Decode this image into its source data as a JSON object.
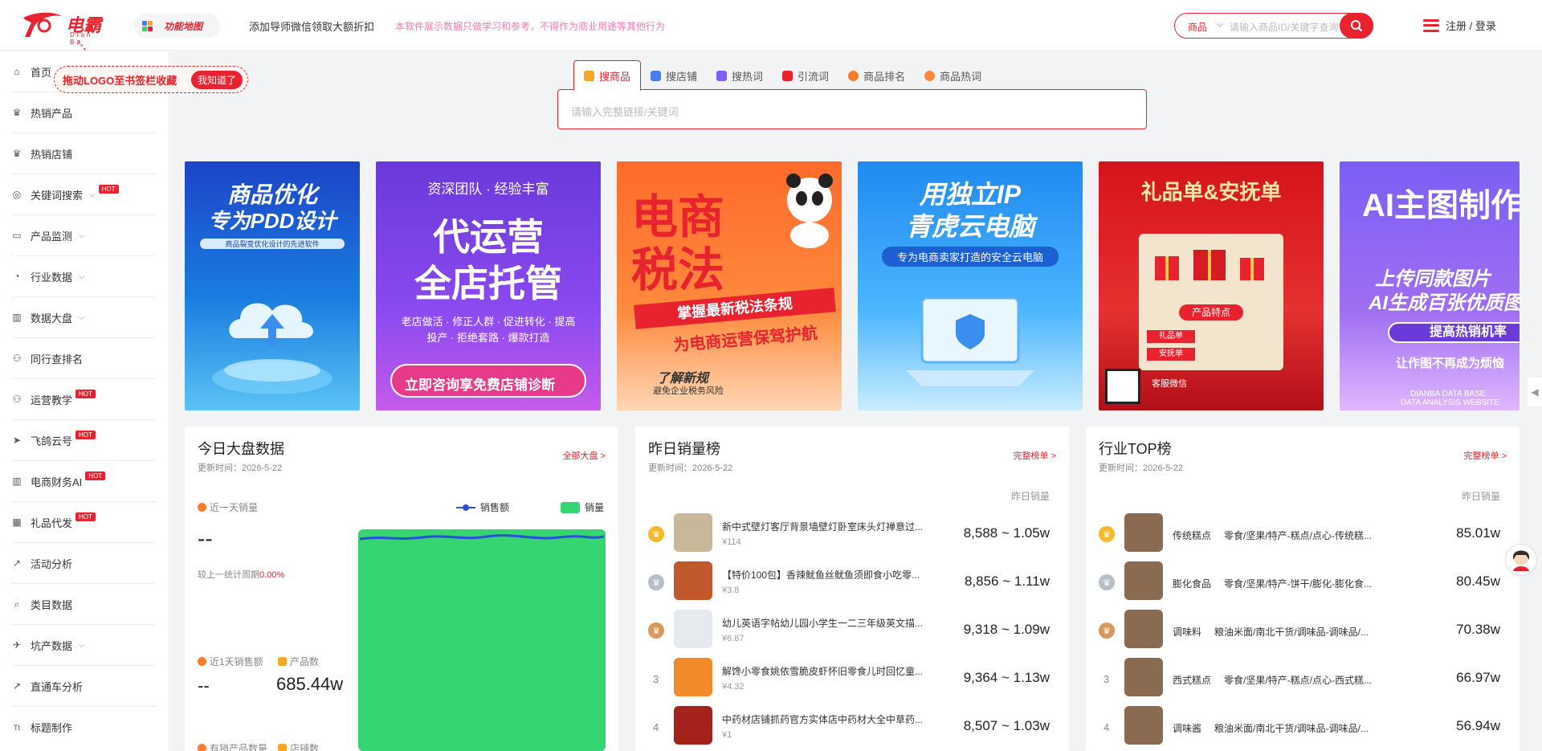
{
  "header": {
    "logo_text": "电霸",
    "logo_sub": "Dian Ba",
    "func_map": "功能地图",
    "notice": "添加导师微信领取大额折扣",
    "warning": "本软件展示数据只做学习和参考，不得作为商业用途等其他行为",
    "search_select": "商品",
    "search_placeholder": "请输入商品ID/关键字查询",
    "login": "注册 / 登录"
  },
  "tooltip": {
    "text": "拖动LOGO至书签栏收藏",
    "button": "我知道了"
  },
  "sidebar": {
    "items": [
      {
        "label": "首页",
        "icon": "home-icon"
      },
      {
        "label": "热销产品",
        "icon": "crown-icon"
      },
      {
        "label": "热销店铺",
        "icon": "crown-icon"
      },
      {
        "label": "关键词搜索",
        "icon": "search-icon",
        "chevron": true,
        "hot": "HOT"
      },
      {
        "label": "产品监测",
        "icon": "monitor-icon",
        "chevron": true
      },
      {
        "label": "行业数据",
        "icon": "pie-icon",
        "chevron": true
      },
      {
        "label": "数据大盘",
        "icon": "chart-icon",
        "chevron": true
      },
      {
        "label": "同行查排名",
        "icon": "users-icon"
      },
      {
        "label": "运营教学",
        "icon": "users-icon",
        "hot": "HOT"
      },
      {
        "label": "飞鸽云号",
        "icon": "send-icon",
        "hot": "HOT"
      },
      {
        "label": "电商财务AI",
        "icon": "chart-icon",
        "hot": "HOT"
      },
      {
        "label": "礼品代发",
        "icon": "gift-icon",
        "hot": "HOT"
      },
      {
        "label": "活动分析",
        "icon": "line-icon"
      },
      {
        "label": "类目数据",
        "icon": "search-icon"
      },
      {
        "label": "坑产数据",
        "icon": "rocket-icon",
        "chevron": true
      },
      {
        "label": "直通车分析",
        "icon": "line-icon"
      },
      {
        "label": "标题制作",
        "icon": "title-icon"
      }
    ]
  },
  "search_tabs": [
    {
      "label": "搜商品",
      "color": "#f5a623"
    },
    {
      "label": "搜店铺",
      "color": "#4a7cf5"
    },
    {
      "label": "搜热词",
      "color": "#7b5ef5"
    },
    {
      "label": "引流词",
      "color": "#e8232f"
    },
    {
      "label": "商品排名",
      "color": "#ff7a2a"
    },
    {
      "label": "商品热词",
      "color": "#ff8a3e"
    }
  ],
  "main_search_placeholder": "请输入完整链接/关键词",
  "banners": [
    {
      "t1": "商品优化",
      "t2": "专为PDD设计",
      "t3": "商品裂变优化设计的先进软件"
    },
    {
      "t1": "代运营",
      "t2": "全店托管",
      "t0": "资深团队 · 经验丰富",
      "t3": "老店做活 · 修正人群 · 促进转化 · 提高投产 · 拒绝套路 · 爆款打造",
      "t4": "立即咨询享免费店铺诊断"
    },
    {
      "t1": "电商",
      "t2": "税法",
      "t3": "掌握最新税法条规",
      "t4": "为电商运营保驾护航",
      "t5": "了解新规",
      "t6": "避免企业税务风险"
    },
    {
      "t1": "用独立IP",
      "t2": "青虎云电脑",
      "t3": "专为电商卖家打造的安全云电脑"
    },
    {
      "t1": "礼品单&安抚单",
      "t3": "产品特点",
      "t4": "礼品单",
      "t5": "安抚单",
      "t6": "客服微信"
    },
    {
      "t1": "AI主图制作",
      "t2": "上传同款图片",
      "t3": "AI生成百张优质图",
      "t4": "提高热销机率",
      "t5": "让作图不再成为烦恼",
      "t6": "DIANBA DATA BASE",
      "t7": "DATA ANALYSIS WEBSITE"
    }
  ],
  "panel_today": {
    "title": "今日大盘数据",
    "updated": "更新时间：2026-5-22",
    "link": "全部大盘 >",
    "kpi1_label": "近一天销量",
    "kpi1_value": "--",
    "compare_text": "较上一统计周期",
    "compare_value": "0.00%",
    "legend_sales_amount": "销售额",
    "legend_sales": "销量",
    "kpi2_label": "近1天销售额",
    "kpi2_value": "--",
    "kpi3_label": "产品数",
    "kpi3_value": "685.44w",
    "kpi4_label": "有销产品数量",
    "kpi5_label": "店铺数"
  },
  "panel_sales": {
    "title": "昨日销量榜",
    "updated": "更新时间：2026-5-22",
    "link": "完整榜单 >",
    "col": "昨日销量",
    "rows": [
      {
        "name": "新中式壁灯客厅背景墙壁灯卧室床头灯禅意过...",
        "price": "¥114",
        "value": "8,588 ~ 1.05w",
        "thumb": "#c9b79a"
      },
      {
        "name": "【特价100包】香辣鱿鱼丝鱿鱼须即食小吃零...",
        "price": "¥3.8",
        "value": "8,856 ~ 1.11w",
        "thumb": "#c0582b"
      },
      {
        "name": "幼儿英语字帖幼儿园小学生一二三年级英文描...",
        "price": "¥6.87",
        "value": "9,318 ~ 1.09w",
        "thumb": "#e6e9ee"
      },
      {
        "rank": "3",
        "name": "解馋小零食姚依雪脆皮虾怀旧零食儿时回忆童...",
        "price": "¥4.32",
        "value": "9,364 ~ 1.13w",
        "thumb": "#f08a2a"
      },
      {
        "rank": "4",
        "name": "中药材店铺抓药官方实体店中药材大全中草药...",
        "price": "¥1",
        "value": "8,507 ~ 1.03w",
        "thumb": "#a3221c"
      }
    ]
  },
  "panel_industry": {
    "title": "行业TOP榜",
    "updated": "更新时间：2026-5-22",
    "link": "完整榜单 >",
    "col": "昨日销量",
    "rows": [
      {
        "name": "传统糕点",
        "sub": "零食/坚果/特产-糕点/点心-传统糕...",
        "value": "85.01w"
      },
      {
        "name": "膨化食品",
        "sub": "零食/坚果/特产-饼干/膨化-膨化食...",
        "value": "80.45w"
      },
      {
        "name": "调味料",
        "sub": "粮油米面/南北干货/调味品-调味品/...",
        "value": "70.38w"
      },
      {
        "rank": "3",
        "name": "西式糕点",
        "sub": "零食/坚果/特产-糕点/点心-西式糕...",
        "value": "66.97w"
      },
      {
        "rank": "4",
        "name": "调味酱",
        "sub": "粮油米面/南北干货/调味品-调味品/...",
        "value": "56.94w"
      }
    ]
  }
}
